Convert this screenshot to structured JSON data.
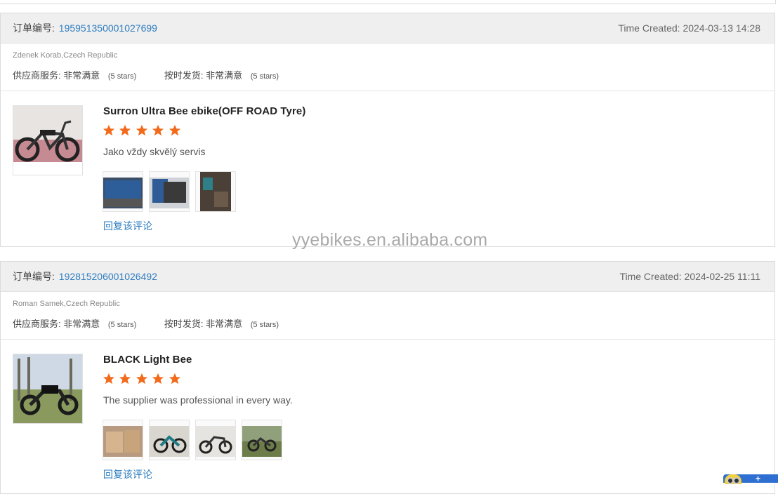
{
  "order_label": "订单编号:",
  "time_label": "Time Created:",
  "stars_note": "(5 stars)",
  "reply_label": "回复该评论",
  "supplier_service_label": "供应商服务:",
  "on_time_label": "按时发货:",
  "rating_text": "非常满意",
  "watermark": "yyebikes.en.alibaba.com",
  "colors": {
    "star": "#f26a1b",
    "link": "#2e7dc0",
    "header_bg": "#efefef"
  },
  "reviews": [
    {
      "order_number": "195951350001027699",
      "time_created": "2024-03-13 14:28",
      "buyer": "Zdenek Korab,Czech Republic",
      "product_name": "Surron Ultra Bee ebike(OFF ROAD Tyre)",
      "rating": 5,
      "comment": "Jako vždy skvělý servis",
      "photo_count": 3
    },
    {
      "order_number": "192815206001026492",
      "time_created": "2024-02-25 11:11",
      "buyer": "Roman Samek,Czech Republic",
      "product_name": "BLACK Light Bee",
      "rating": 5,
      "comment": "The supplier was professional in every way.",
      "photo_count": 4
    }
  ]
}
